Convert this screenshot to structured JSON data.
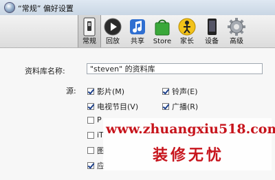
{
  "window": {
    "title": "“常规” 偏好设置"
  },
  "toolbar": {
    "items": [
      {
        "label": "常规",
        "icon": "switch-icon"
      },
      {
        "label": "回放",
        "icon": "play-icon"
      },
      {
        "label": "共享",
        "icon": "music-share-icon"
      },
      {
        "label": "Store",
        "icon": "store-bag-icon"
      },
      {
        "label": "家长",
        "icon": "parental-icon"
      },
      {
        "label": "设备",
        "icon": "device-icon"
      },
      {
        "label": "高级",
        "icon": "gear-icon"
      }
    ],
    "selected": "常规"
  },
  "library": {
    "label": "资料库名称:",
    "value": "\"steven\" 的资料库"
  },
  "sources": {
    "label": "源:",
    "items": [
      {
        "label": "影片(M)",
        "checked": true
      },
      {
        "label": "铃声(E)",
        "checked": true
      },
      {
        "label": "电视节目(V)",
        "checked": true
      },
      {
        "label": "广播(R)",
        "checked": true
      },
      {
        "label": "P",
        "checked": false
      },
      {
        "label": "iT",
        "checked": false
      },
      {
        "label": "图",
        "checked": false
      },
      {
        "label": "应",
        "checked": true
      }
    ]
  },
  "watermark": {
    "url": "www.zhuangxiu518.com",
    "name": "装修无忧"
  },
  "colors": {
    "watermark": "#c7141c",
    "toolbar_bg": "#e6e6e6",
    "titlebar_bg": "#d6e1ee"
  }
}
